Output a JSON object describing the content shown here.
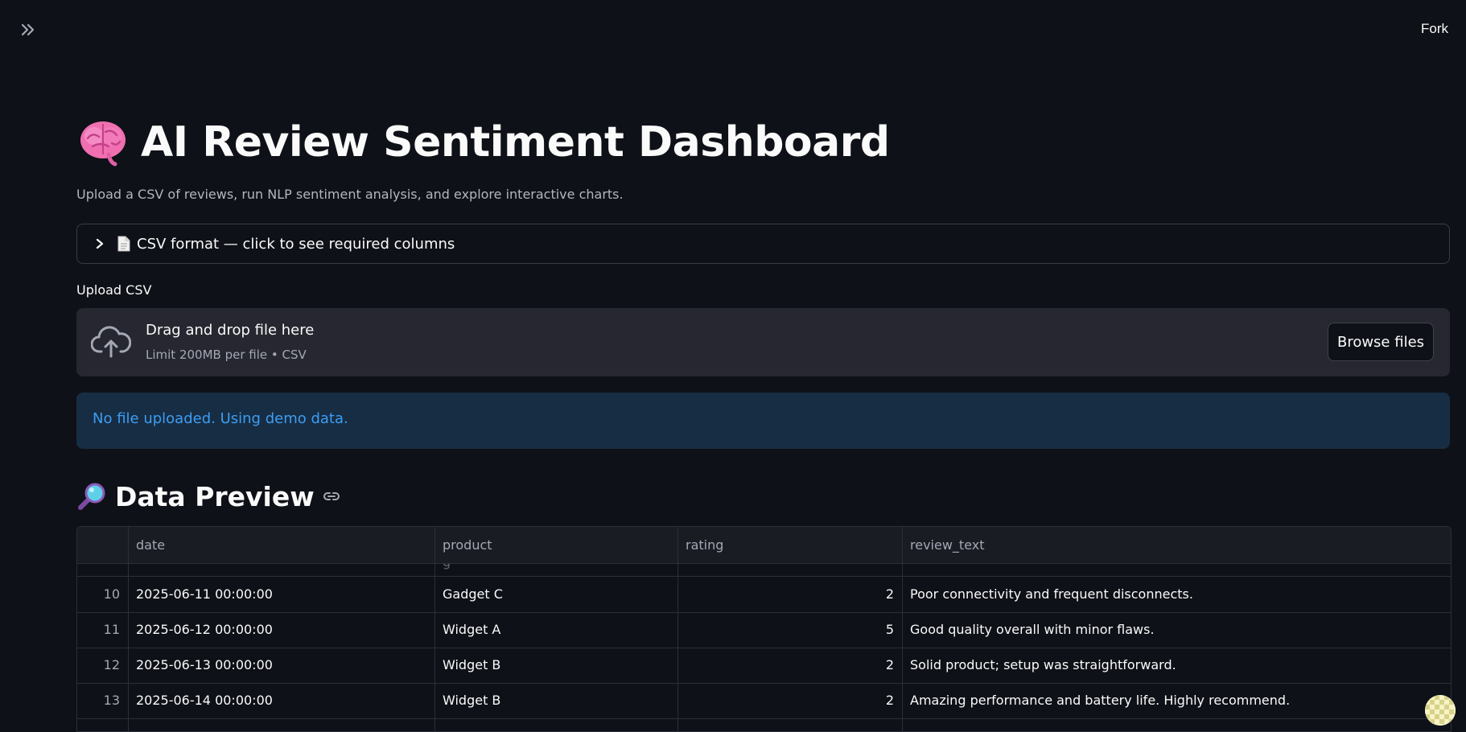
{
  "topbar": {
    "fork_label": "Fork"
  },
  "header": {
    "title": "AI Review Sentiment Dashboard",
    "subtitle": "Upload a CSV of reviews, run NLP sentiment analysis, and explore interactive charts."
  },
  "expander": {
    "label": "CSV format — click to see required columns"
  },
  "upload": {
    "label": "Upload CSV",
    "drop_title": "Drag and drop file here",
    "drop_subtitle": "Limit 200MB per file • CSV",
    "browse_label": "Browse files"
  },
  "info": {
    "message": "No file uploaded. Using demo data."
  },
  "section": {
    "title": "Data Preview"
  },
  "table": {
    "columns": [
      "date",
      "product",
      "rating",
      "review_text"
    ],
    "partial_top_fragment": "g",
    "rows": [
      {
        "index": "10",
        "date": "2025-06-11 00:00:00",
        "product": "Gadget C",
        "rating": "2",
        "review_text": "Poor connectivity and frequent disconnects."
      },
      {
        "index": "11",
        "date": "2025-06-12 00:00:00",
        "product": "Widget A",
        "rating": "5",
        "review_text": "Good quality overall with minor flaws."
      },
      {
        "index": "12",
        "date": "2025-06-13 00:00:00",
        "product": "Widget B",
        "rating": "2",
        "review_text": "Solid product; setup was straightforward."
      },
      {
        "index": "13",
        "date": "2025-06-14 00:00:00",
        "product": "Widget B",
        "rating": "2",
        "review_text": "Amazing performance and battery life. Highly recommend."
      }
    ]
  },
  "colors": {
    "background": "#0e1117",
    "info_bg": "#172d43",
    "info_text": "#3d9df3",
    "dropzone_bg": "#262730"
  }
}
